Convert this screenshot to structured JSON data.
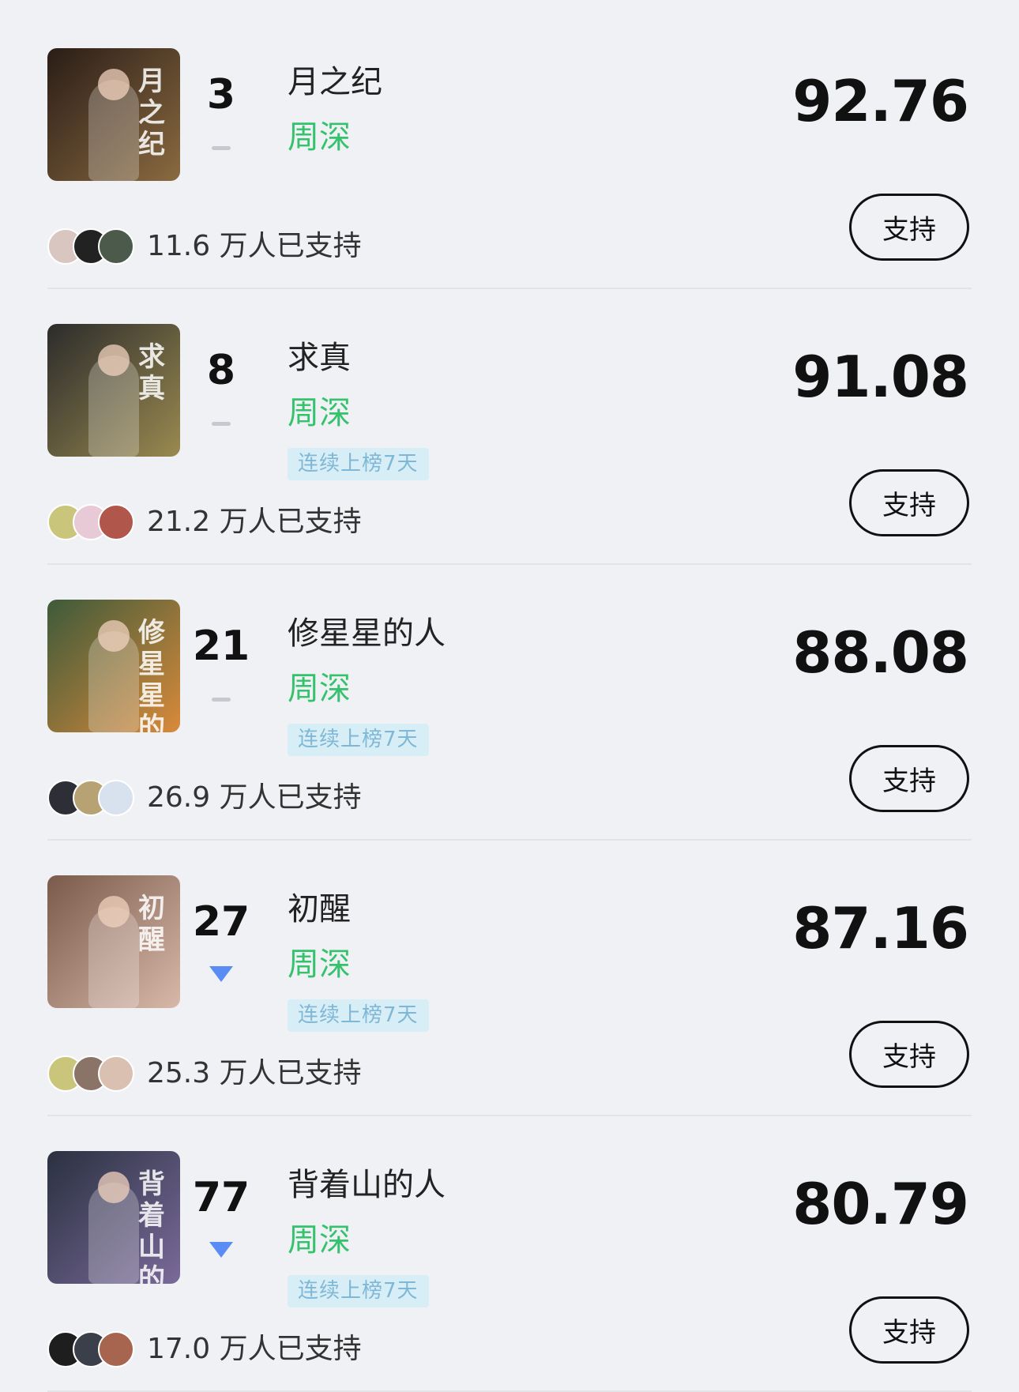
{
  "items": [
    {
      "rank": "3",
      "trend": "flat",
      "title": "月之纪",
      "artist": "周深",
      "tag": "",
      "score": "92.76",
      "supporters": "11.6 万人已支持",
      "button_label": "支持",
      "cover_text": "月之纪",
      "colors": {
        "cover_from": "#2a1d17",
        "cover_to": "#8a6a40",
        "avatar1": "#d9c6c0",
        "avatar2": "#222222",
        "avatar3": "#4b5a4a"
      }
    },
    {
      "rank": "8",
      "trend": "flat",
      "title": "求真",
      "artist": "周深",
      "tag": "连续上榜7天",
      "score": "91.08",
      "supporters": "21.2 万人已支持",
      "button_label": "支持",
      "cover_text": "求真",
      "colors": {
        "cover_from": "#2b2b2b",
        "cover_to": "#9a8a50",
        "avatar1": "#c9c57a",
        "avatar2": "#e8c9d6",
        "avatar3": "#b0564a"
      }
    },
    {
      "rank": "21",
      "trend": "flat",
      "title": "修星星的人",
      "artist": "周深",
      "tag": "连续上榜7天",
      "score": "88.08",
      "supporters": "26.9 万人已支持",
      "button_label": "支持",
      "cover_text": "修星星的人",
      "colors": {
        "cover_from": "#3d5a3a",
        "cover_to": "#d98a3a",
        "avatar1": "#2e2f36",
        "avatar2": "#b7a274",
        "avatar3": "#d7e2ee"
      }
    },
    {
      "rank": "27",
      "trend": "down",
      "title": "初醒",
      "artist": "周深",
      "tag": "连续上榜7天",
      "score": "87.16",
      "supporters": "25.3 万人已支持",
      "button_label": "支持",
      "cover_text": "初醒",
      "colors": {
        "cover_from": "#7a5a4a",
        "cover_to": "#d8b8a8",
        "avatar1": "#c9c57a",
        "avatar2": "#8a7468",
        "avatar3": "#d9c0b0"
      }
    },
    {
      "rank": "77",
      "trend": "down",
      "title": "背着山的人",
      "artist": "周深",
      "tag": "连续上榜7天",
      "score": "80.79",
      "supporters": "17.0 万人已支持",
      "button_label": "支持",
      "cover_text": "背着山的人",
      "colors": {
        "cover_from": "#2a3140",
        "cover_to": "#7a6a9a",
        "avatar1": "#1e1e1e",
        "avatar2": "#3a3f4a",
        "avatar3": "#a7644e"
      }
    }
  ]
}
